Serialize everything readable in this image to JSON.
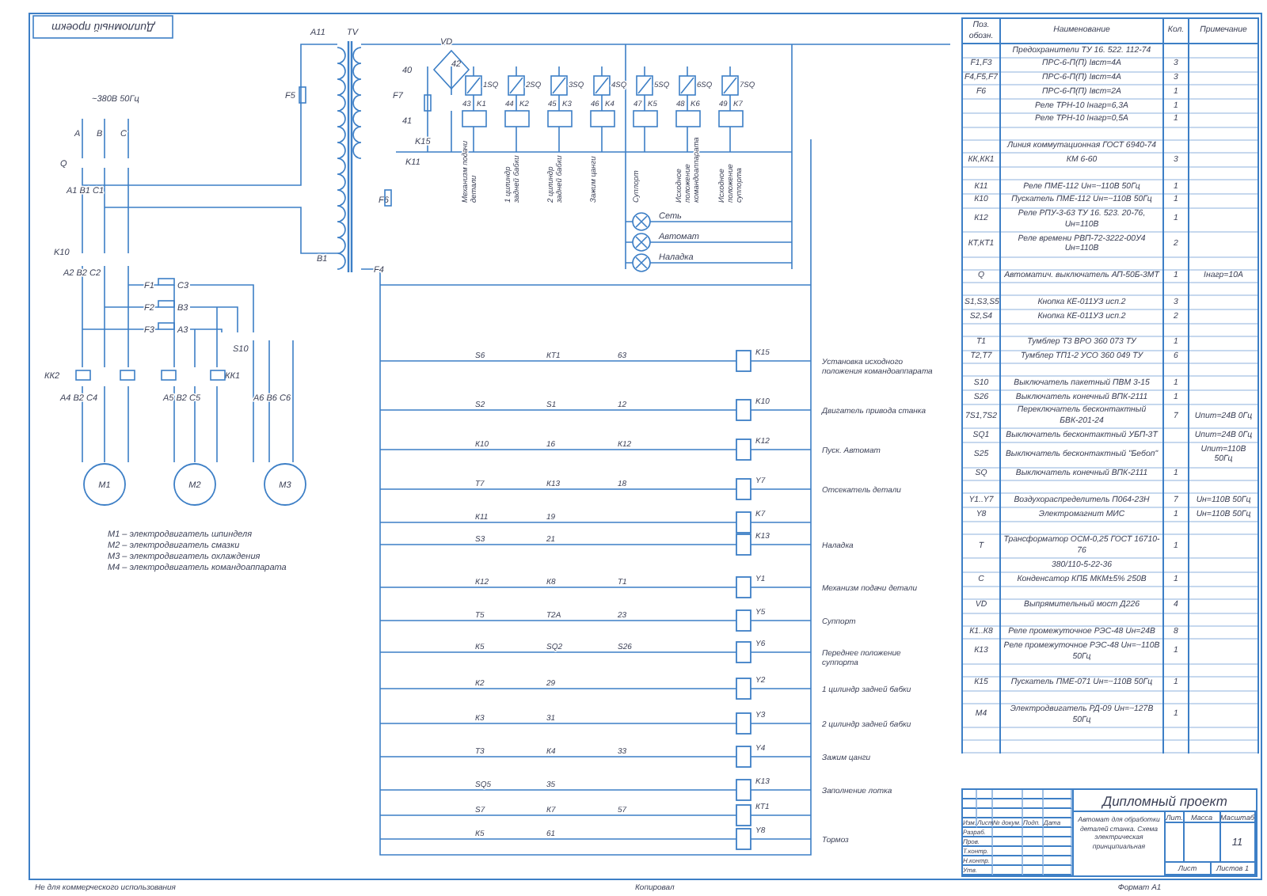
{
  "frame_stamp": "Дипломный проект",
  "supply": {
    "label": "~380В 50Гц",
    "phases": [
      "A",
      "B",
      "C"
    ]
  },
  "power_labels": [
    "Q",
    "A1 B1 C1",
    "K10",
    "A2 B2 C2",
    "F1",
    "F2",
    "F3",
    "C3",
    "B3",
    "A3",
    "КК2",
    "КК1",
    "S10",
    "A4 B2 C4",
    "A5 B2 C5",
    "A6 B6 C6"
  ],
  "motors": [
    "M1",
    "M2",
    "M3"
  ],
  "motor_legend": [
    "М1 – электродвигатель шпинделя",
    "М2 – электродвигатель смазки",
    "М3 – электродвигатель охлаждения",
    "М4 – электродвигатель командоаппарата"
  ],
  "transformer_labels": [
    "A11",
    "TV",
    "B1",
    "F5",
    "F6",
    "F7",
    "F4",
    "VD",
    "40",
    "41",
    "42",
    "K15",
    "K11"
  ],
  "valves": [
    {
      "coil": "K1",
      "switch": "1SQ",
      "wire": "43",
      "label": "Механизм подачи детали"
    },
    {
      "coil": "K2",
      "switch": "2SQ",
      "wire": "44",
      "label": "1 цилиндр задней бабки"
    },
    {
      "coil": "K3",
      "switch": "3SQ",
      "wire": "45",
      "label": "2 цилиндр задней бабки"
    },
    {
      "coil": "K4",
      "switch": "4SQ",
      "wire": "46",
      "label": "Зажим цанги"
    },
    {
      "coil": "K5",
      "switch": "5SQ",
      "wire": "47",
      "label": "Суппорт"
    },
    {
      "coil": "K6",
      "switch": "6SQ",
      "wire": "48",
      "label": "Исходное положение командоаппарата"
    },
    {
      "coil": "K7",
      "switch": "7SQ",
      "wire": "49",
      "label": "Исходное положение суппорта"
    }
  ],
  "lamps": [
    "Сеть",
    "Автомат",
    "Наладка"
  ],
  "rungs": [
    {
      "coil": "K15",
      "label": "Установка исходного положения командоаппарата",
      "contacts": [
        "S6",
        "КТ1",
        "63"
      ]
    },
    {
      "coil": "K10",
      "label": "Двигатель привода станка",
      "contacts": [
        "S2",
        "S1",
        "12"
      ]
    },
    {
      "coil": "K12",
      "label": "Пуск. Автомат",
      "contacts": [
        "К10",
        "16",
        "К12"
      ]
    },
    {
      "coil": "Y7",
      "label": "Отсекатель детали",
      "contacts": [
        "T7",
        "К13",
        "18"
      ]
    },
    {
      "coil": "K7",
      "contacts": [
        "К11",
        "19"
      ]
    },
    {
      "coil": "K13",
      "label": "Наладка",
      "contacts": [
        "S3",
        "21"
      ]
    },
    {
      "coil": "Y1",
      "label": "Механизм подачи детали",
      "contacts": [
        "К12",
        "К8",
        "Т1"
      ]
    },
    {
      "coil": "Y5",
      "label": "Суппорт",
      "contacts": [
        "Т5",
        "Т2А",
        "23"
      ]
    },
    {
      "coil": "Y6",
      "label": "Переднее положение суппорта",
      "contacts": [
        "К5",
        "SQ2",
        "S26"
      ]
    },
    {
      "coil": "Y2",
      "label": "1 цилиндр задней бабки",
      "contacts": [
        "К2",
        "29"
      ]
    },
    {
      "coil": "Y3",
      "label": "2 цилиндр задней бабки",
      "contacts": [
        "К3",
        "31"
      ]
    },
    {
      "coil": "Y4",
      "label": "Зажим цанги",
      "contacts": [
        "Т3",
        "К4",
        "33"
      ]
    },
    {
      "coil": "K13",
      "label": "Заполнение лотка",
      "contacts": [
        "SQ5",
        "35"
      ]
    },
    {
      "coil": "КТ1",
      "contacts": [
        "S7",
        "К7",
        "57"
      ]
    },
    {
      "coil": "Y8",
      "label": "Тормоз",
      "contacts": [
        "К5",
        "61"
      ]
    }
  ],
  "parts_table": {
    "columns": [
      "Поз. обозн.",
      "Наименование",
      "Кол.",
      "Примечание"
    ],
    "rows": [
      {
        "kind": "item",
        "name": "Предохранители ТУ 16. 522. 112-74"
      },
      {
        "kind": "item",
        "ref": "F1,F3",
        "name": "ПРС-6-П(П) Iвст=4А",
        "qty": "3"
      },
      {
        "kind": "item",
        "ref": "F4,F5,F7",
        "name": "ПРС-6-П(П) Iвст=4А",
        "qty": "3"
      },
      {
        "kind": "item",
        "ref": "F6",
        "name": "ПРС-6-П(П) Iвст=2А",
        "qty": "1"
      },
      {
        "kind": "item",
        "name": "Реле ТРН-10 Iнагр=6,3А",
        "qty": "1"
      },
      {
        "kind": "item",
        "name": "Реле ТРН-10 Iнагр=0,5А",
        "qty": "1"
      },
      {
        "kind": "spacer"
      },
      {
        "kind": "item",
        "name": "Линия коммутационная ГОСТ 6940-74"
      },
      {
        "kind": "item",
        "ref": "КК,КК1",
        "name": "КМ 6-60",
        "qty": "3"
      },
      {
        "kind": "spacer"
      },
      {
        "kind": "item",
        "ref": "К11",
        "name": "Реле ПМЕ-112 Uн=~110В 50Гц",
        "qty": "1"
      },
      {
        "kind": "item",
        "ref": "К10",
        "name": "Пускатель ПМЕ-112 Uн=~110В 50Гц",
        "qty": "1"
      },
      {
        "kind": "item",
        "ref": "К12",
        "name": "Реле РПУ-3-63 ТУ 16. 523. 20-76, Uн=110В",
        "qty": "1"
      },
      {
        "kind": "item",
        "ref": "КТ,КТ1",
        "name": "Реле времени РВП-72-3222-00У4 Uн=110В",
        "qty": "2"
      },
      {
        "kind": "spacer"
      },
      {
        "kind": "item",
        "ref": "Q",
        "name": "Автоматич. выключатель АП-50Б-3МТ",
        "qty": "1",
        "note": "Iнагр=10А"
      },
      {
        "kind": "spacer"
      },
      {
        "kind": "item",
        "ref": "S1,S3,S5",
        "name": "Кнопка КЕ-011УЗ исп.2",
        "qty": "3"
      },
      {
        "kind": "item",
        "ref": "S2,S4",
        "name": "Кнопка КЕ-011УЗ исп.2",
        "qty": "2"
      },
      {
        "kind": "spacer"
      },
      {
        "kind": "item",
        "ref": "T1",
        "name": "Тумблер Т3 ВРО 360 073 ТУ",
        "qty": "1"
      },
      {
        "kind": "item",
        "ref": "T2,T7",
        "name": "Тумблер ТП1-2 УСО 360 049 ТУ",
        "qty": "6"
      },
      {
        "kind": "spacer"
      },
      {
        "kind": "item",
        "ref": "S10",
        "name": "Выключатель пакетный ПВМ 3-15",
        "qty": "1"
      },
      {
        "kind": "item",
        "ref": "S26",
        "name": "Выключатель конечный ВПК-2111",
        "qty": "1"
      },
      {
        "kind": "item",
        "ref": "7S1,7S2",
        "name": "Переключатель бесконтактный БВК-201-24",
        "qty": "7",
        "note": "Uпит=24В 0Гц"
      },
      {
        "kind": "item",
        "ref": "SQ1",
        "name": "Выключатель бесконтактный УБП-3Т",
        "note": "Uпит=24В 0Гц"
      },
      {
        "kind": "item",
        "ref": "S25",
        "name": "Выключатель бесконтактный \"Бебоп\"",
        "note": "Uпит=110В 50Гц"
      },
      {
        "kind": "item",
        "ref": "SQ",
        "name": "Выключатель конечный ВПК-2111",
        "qty": "1"
      },
      {
        "kind": "spacer"
      },
      {
        "kind": "item",
        "ref": "Y1..Y7",
        "name": "Воздухораспределитель П064-23Н",
        "qty": "7",
        "note": "Uн=110В 50Гц"
      },
      {
        "kind": "item",
        "ref": "Y8",
        "name": "Электромагнит МИС",
        "qty": "1",
        "note": "Uн=110В 50Гц"
      },
      {
        "kind": "spacer"
      },
      {
        "kind": "item",
        "ref": "T",
        "name": "Трансформатор ОСМ-0,25 ГОСТ 16710-76",
        "qty": "1"
      },
      {
        "kind": "item",
        "name": "380/110-5-22-36"
      },
      {
        "kind": "item",
        "ref": "C",
        "name": "Конденсатор КПБ МКМ±5% 250В",
        "qty": "1"
      },
      {
        "kind": "spacer"
      },
      {
        "kind": "item",
        "ref": "VD",
        "name": "Выпрямительный мост Д226",
        "qty": "4"
      },
      {
        "kind": "spacer"
      },
      {
        "kind": "item",
        "ref": "К1..К8",
        "name": "Реле промежуточное РЭС-48 Uн=24В",
        "qty": "8"
      },
      {
        "kind": "item",
        "ref": "К13",
        "name": "Реле промежуточное РЭС-48 Uн=~110В 50Гц",
        "qty": "1"
      },
      {
        "kind": "spacer"
      },
      {
        "kind": "item",
        "ref": "К15",
        "name": "Пускатель ПМЕ-071 Uн=~110В 50Гц",
        "qty": "1"
      },
      {
        "kind": "spacer"
      },
      {
        "kind": "item",
        "ref": "М4",
        "name": "Электродвигатель РД-09 Uн=~127В 50Гц",
        "qty": "1"
      },
      {
        "kind": "spacer"
      },
      {
        "kind": "spacer"
      }
    ]
  },
  "title_block": {
    "title": "Дипломный проект",
    "description": "Автомат для обработки деталей станка. Схема электрическая принципиальная",
    "sign_headers": [
      "Изм.",
      "Лист",
      "№ докум.",
      "Подп.",
      "Дата"
    ],
    "roles": [
      "Разраб.",
      "Пров.",
      "Т.контр.",
      "Н.контр.",
      "Утв."
    ],
    "info_headers": [
      "Лит.",
      "Масса",
      "Масштаб"
    ],
    "scale": "11",
    "sheet": "Лист",
    "sheets": "Листов 1"
  },
  "footer": {
    "note": "Не для коммерческого использования",
    "copied": "Копировал",
    "format": "Формат А1"
  }
}
